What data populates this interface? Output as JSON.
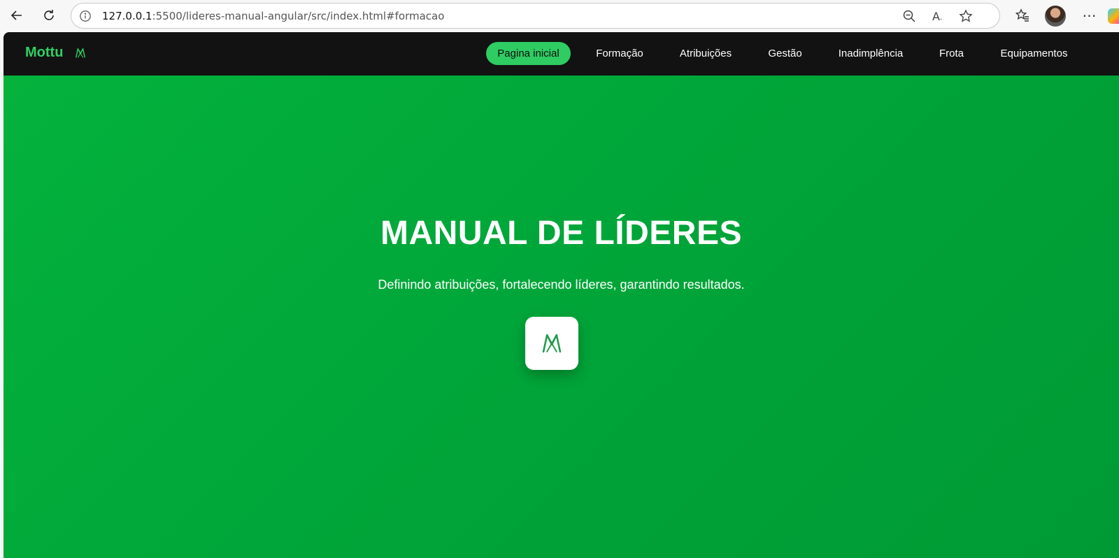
{
  "browser": {
    "url_host": "127.0.0.1",
    "url_path": ":5500/lideres-manual-angular/src/index.html#formacao"
  },
  "icons": {
    "back": "back-arrow-icon",
    "reload": "reload-icon",
    "site_info": "info-icon",
    "zoom": "zoom-out-icon",
    "read_aloud": "read-aloud-icon",
    "favorite": "star-icon",
    "favorites": "favorites-icon",
    "profile": "avatar",
    "more": "more-icon",
    "brand_logo": "mottu-logo-icon"
  },
  "site": {
    "brand": "Mottu",
    "nav": {
      "home": "Pagina inicial",
      "formacao": "Formação",
      "atribuicoes": "Atribuições",
      "gestao": "Gestão",
      "inadimplencia": "Inadimplência",
      "frota": "Frota",
      "equipamentos": "Equipamentos"
    }
  },
  "hero": {
    "title": "MANUAL DE LÍDERES",
    "subtitle": "Definindo atribuições, fortalecendo líderes, garantindo resultados."
  },
  "colors": {
    "brand_green": "#2fcf63",
    "nav_bg": "#121212",
    "hero_green": "#00a639",
    "active_pill": "#2ecc62"
  }
}
